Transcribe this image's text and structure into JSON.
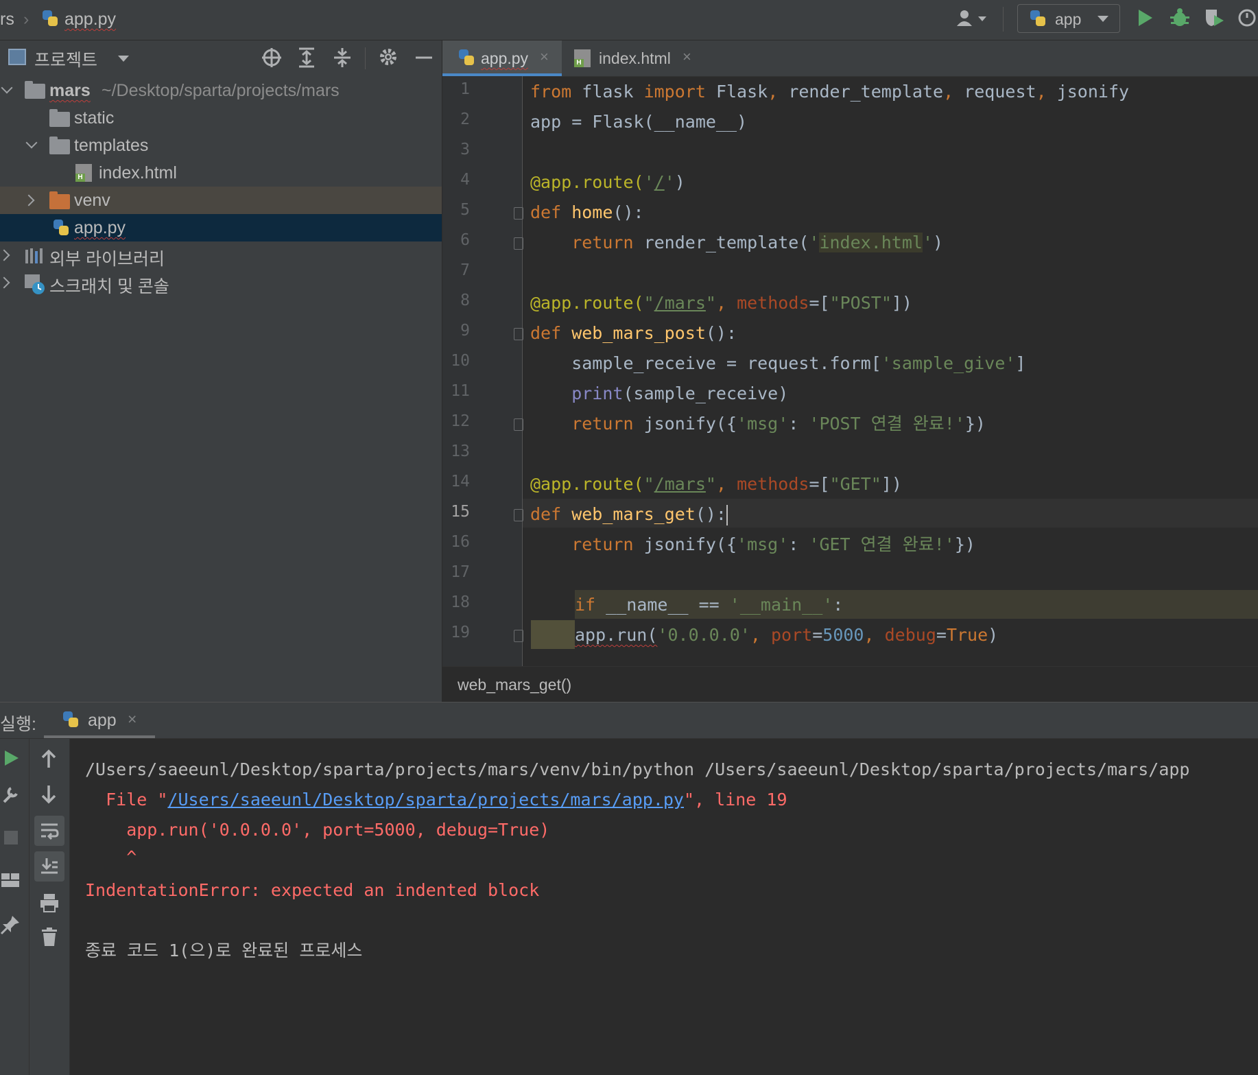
{
  "navbar": {
    "project_crumb": "rs",
    "file_crumb": "app.py",
    "run_config": "app"
  },
  "project_panel": {
    "title": "프로젝트",
    "tree": {
      "root": {
        "name": "mars",
        "path": "~/Desktop/sparta/projects/mars"
      },
      "static": "static",
      "templates": "templates",
      "index": "index.html",
      "venv": "venv",
      "app": "app.py",
      "external": "외부 라이브러리",
      "scratches": "스크래치 및 콘솔"
    }
  },
  "editor": {
    "tabs": [
      {
        "label": "app.py",
        "active": true
      },
      {
        "label": "index.html",
        "active": false
      }
    ],
    "line_numbers": [
      "1",
      "2",
      "3",
      "4",
      "5",
      "6",
      "7",
      "8",
      "9",
      "10",
      "11",
      "12",
      "13",
      "14",
      "15",
      "16",
      "17",
      "18",
      "19"
    ],
    "current_line": "15",
    "breadcrumb": "web_mars_get()",
    "code": {
      "l1": {
        "a": "from",
        "b": " flask ",
        "c": "import",
        "d": " Flask",
        "e": ",",
        "f": " render_template",
        "g": ",",
        "h": " request",
        "i": ",",
        "j": " jsonify"
      },
      "l2": "app = Flask(__name__)",
      "l4": {
        "dec": "@app.route(",
        "q1": "'",
        "path": "/",
        "q2": "'",
        "close": ")"
      },
      "l5": {
        "kw": "def",
        "fn": " home",
        "rest": "():"
      },
      "l6": {
        "kw": "    return",
        "a": " render_template(",
        "q1": "'",
        "s": "index.html",
        "q2": "'",
        "b": ")"
      },
      "l8": {
        "dec": "@app.route(",
        "q1": "\"",
        "path": "/mars",
        "q2": "\"",
        "comma": ",",
        "prm": " methods",
        "eq": "=[",
        "s": "\"POST\"",
        "close": "])"
      },
      "l9": {
        "kw": "def",
        "fn": " web_mars_post",
        "rest": "():"
      },
      "l10": {
        "a": "    sample_receive = request.form[",
        "s": "'sample_give'",
        "b": "]"
      },
      "l11": {
        "bi": "    print",
        "a": "(sample_receive)"
      },
      "l12": {
        "kw": "    return",
        "a": " jsonify({",
        "s1": "'msg'",
        "b": ": ",
        "s2": "'POST 연결 완료!'",
        "c": "})"
      },
      "l14": {
        "dec": "@app.route(",
        "q1": "\"",
        "path": "/mars",
        "q2": "\"",
        "comma": ",",
        "prm": " methods",
        "eq": "=[",
        "s": "\"GET\"",
        "close": "])"
      },
      "l15": {
        "kw": "def",
        "fn": " web_mars_get",
        "rest": "():"
      },
      "l16": {
        "kw": "    return",
        "a": " jsonify({",
        "s1": "'msg'",
        "b": ": ",
        "s2": "'GET 연결 완료!'",
        "c": "})"
      },
      "l18": {
        "kw": "if",
        "a": " __name__ == ",
        "s": "'__main__'",
        "b": ":"
      },
      "l19": {
        "a": "app.run(",
        "s": "'0.0.0.0'",
        "c1": ",",
        "p1": " port",
        "eq1": "=",
        "n": "5000",
        "c2": ",",
        "p2": " debug",
        "eq2": "=",
        "t": "True",
        "b": ")"
      }
    }
  },
  "run_panel": {
    "label": "실행:",
    "tab": "app",
    "output": {
      "cmd": "/Users/saeeunl/Desktop/sparta/projects/mars/venv/bin/python /Users/saeeunl/Desktop/sparta/projects/mars/app",
      "file_prefix": "  File \"",
      "file_link": "/Users/saeeunl/Desktop/sparta/projects/mars/app.py",
      "file_suffix": "\", line 19",
      "code_line": "    app.run('0.0.0.0', port=5000, debug=True)",
      "caret": "    ^",
      "error": "IndentationError: expected an indented block",
      "exit": "종료 코드 1(으)로 완료된 프로세스"
    }
  },
  "colors": {
    "accent": "#4a88c7",
    "run_green": "#59a869",
    "error": "#ff6b68",
    "link": "#589df6"
  }
}
